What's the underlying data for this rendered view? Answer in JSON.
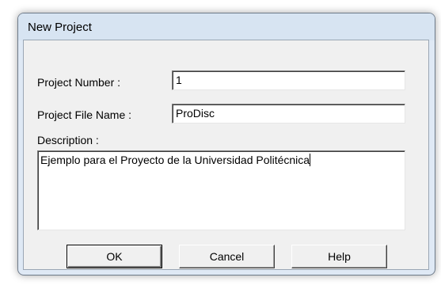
{
  "dialog": {
    "title": "New Project"
  },
  "form": {
    "project_number_label": "Project Number :",
    "project_number_value": "1",
    "project_file_name_label": "Project File Name :",
    "project_file_name_value": "ProDisc",
    "description_label": "Description :",
    "description_value": "Ejemplo para el Proyecto de la Universidad Politécnica"
  },
  "buttons": {
    "ok_label": "OK",
    "cancel_label": "Cancel",
    "help_label": "Help"
  }
}
